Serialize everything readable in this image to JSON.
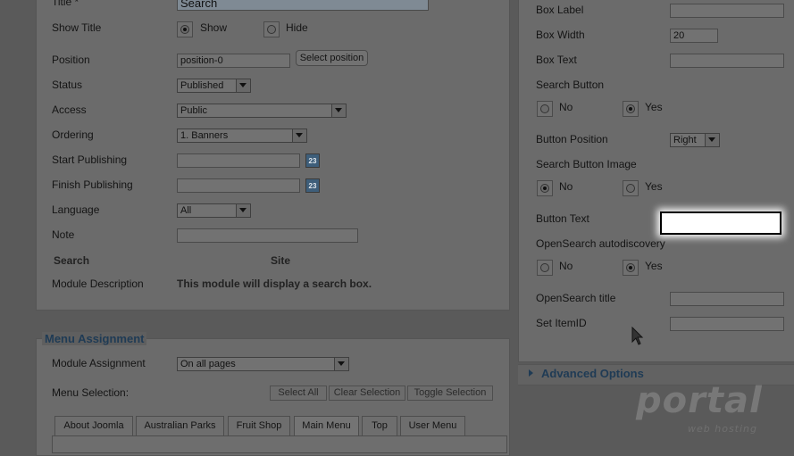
{
  "module": {
    "title_label": "Title *",
    "title_value": "Search",
    "show_title_label": "Show Title",
    "show_label": "Show",
    "hide_label": "Hide",
    "position_label": "Position",
    "position_value": "position-0",
    "select_position_button": "Select position",
    "status_label": "Status",
    "status_value": "Published",
    "access_label": "Access",
    "access_value": "Public",
    "ordering_label": "Ordering",
    "ordering_value": "1. Banners",
    "start_publishing_label": "Start Publishing",
    "finish_publishing_label": "Finish Publishing",
    "calendar_day": "23",
    "language_label": "Language",
    "language_value": "All",
    "note_label": "Note",
    "type_label": "Search",
    "site_label": "Site",
    "module_description_label": "Module Description",
    "module_description_value": "This module will display a search box."
  },
  "menu_assignment": {
    "heading": "Menu Assignment",
    "module_assignment_label": "Module Assignment",
    "module_assignment_value": "On all pages",
    "menu_selection_label": "Menu Selection:",
    "select_all": "Select All",
    "clear_selection": "Clear Selection",
    "toggle_selection": "Toggle Selection",
    "tabs": [
      "About Joomla",
      "Australian Parks",
      "Fruit Shop",
      "Main Menu",
      "Top",
      "User Menu"
    ]
  },
  "basic_options": {
    "box_label": "Box Label",
    "box_width_label": "Box Width",
    "box_width_value": "20",
    "box_text_label": "Box Text",
    "search_button_label": "Search Button",
    "no_label": "No",
    "yes_label": "Yes",
    "button_position_label": "Button Position",
    "button_position_value": "Right",
    "search_button_image_label": "Search Button Image",
    "button_text_label": "Button Text",
    "opensearch_autodiscovery_label": "OpenSearch autodiscovery",
    "opensearch_title_label": "OpenSearch title",
    "set_itemid_label": "Set ItemID"
  },
  "advanced_options": {
    "label": "Advanced Options"
  },
  "watermark": {
    "text": "portal",
    "subtext": "web hosting"
  },
  "colors": {
    "overlay_bg": "#5a5a5a",
    "heading_blue": "#1f3b55",
    "highlight": "#ffffff"
  }
}
